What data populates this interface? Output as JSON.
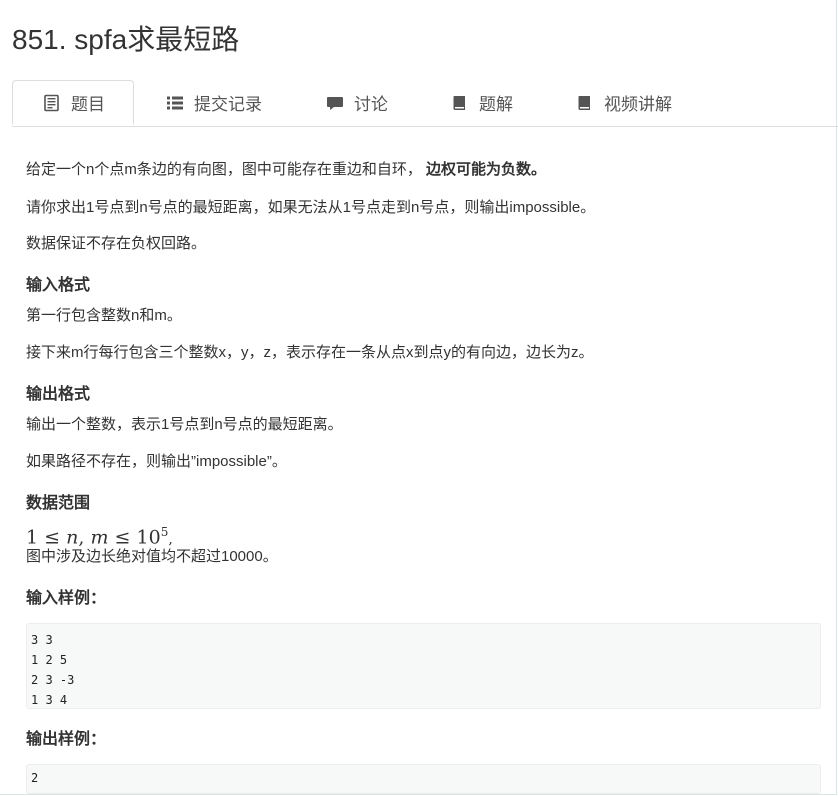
{
  "problem": {
    "title": "851. spfa求最短路"
  },
  "tabs": [
    {
      "label": "题目",
      "icon": "document-icon",
      "active": true
    },
    {
      "label": "提交记录",
      "icon": "list-icon",
      "active": false
    },
    {
      "label": "讨论",
      "icon": "comment-icon",
      "active": false
    },
    {
      "label": "题解",
      "icon": "book-icon",
      "active": false
    },
    {
      "label": "视频讲解",
      "icon": "book-icon",
      "active": false
    }
  ],
  "description": {
    "line1_prefix": "给定一个n个点m条边的有向图，图中可能存在重边和自环，",
    "line1_bold": "边权可能为负数。",
    "line2": "请你求出1号点到n号点的最短距离，如果无法从1号点走到n号点，则输出impossible。",
    "line3": "数据保证不存在负权回路。"
  },
  "input_format": {
    "heading": "输入格式",
    "line1": "第一行包含整数n和m。",
    "line2": "接下来m行每行包含三个整数x，y，z，表示存在一条从点x到点y的有向边，边长为z。"
  },
  "output_format": {
    "heading": "输出格式",
    "line1": "输出一个整数，表示1号点到n号点的最短距离。",
    "line2": "如果路径不存在，则输出”impossible”。"
  },
  "data_range": {
    "heading": "数据范围",
    "math_lhs": "1",
    "math_le": "≤",
    "math_n": "n",
    "math_comma": ",",
    "math_m": "m",
    "math_base": "10",
    "math_exp": "5",
    "math_trail": ",",
    "line2": "图中涉及边长绝对值均不超过10000。"
  },
  "sample_input": {
    "heading": "输入样例：",
    "lines": [
      "3 3",
      "1 2 5",
      "2 3 -3",
      "1 3 4"
    ]
  },
  "sample_output": {
    "heading": "输出样例：",
    "lines": [
      "2"
    ]
  },
  "colors": {
    "text": "#333333",
    "border": "#dddddd",
    "code_bg": "#f7f8f8",
    "icon": "#555555"
  }
}
